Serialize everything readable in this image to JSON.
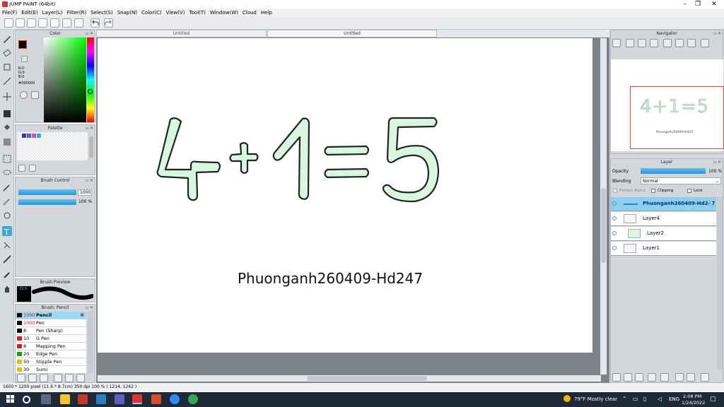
{
  "window": {
    "title": "JUMP PAINT (64bit)"
  },
  "menu": [
    "File(F)",
    "Edit(E)",
    "Layer(L)",
    "Filter(R)",
    "Select(S)",
    "Snap(N)",
    "Color(C)",
    "View(V)",
    "Tool(T)",
    "Window(W)",
    "Cloud",
    "Help"
  ],
  "tabs": [
    {
      "label": "Untitled"
    },
    {
      "label": "Untitled"
    }
  ],
  "panels": {
    "color": {
      "title": "Color",
      "r": "R:0",
      "g": "G:0",
      "b": "B:0",
      "hex": "#000000",
      "current_color": "#000000"
    },
    "palette": {
      "title": "Palette",
      "swatches": [
        "#3b3b9e",
        "#5b5bd0",
        "#d4559e",
        "#3fa7d6"
      ]
    },
    "brush_control": {
      "title": "Brush Control",
      "size": "1000",
      "opacity": "100 %"
    },
    "brush_preview": {
      "title": "Brush Preview",
      "size": "72.5"
    },
    "brush_list": {
      "title": "Brush: Pencil",
      "items": [
        {
          "size": "1000",
          "name": "Pencil",
          "color": "#000000",
          "selected": true
        },
        {
          "size": "1000",
          "name": "Pen",
          "color": "#000000"
        },
        {
          "size": "8",
          "name": "Pen (Sharp)",
          "color": "#000000"
        },
        {
          "size": "10",
          "name": "G Pen",
          "color": "#d32020"
        },
        {
          "size": "8",
          "name": "Mapping Pen",
          "color": "#d32020"
        },
        {
          "size": "20",
          "name": "Edge Pen",
          "color": "#18a018"
        },
        {
          "size": "50",
          "name": "Stipple Pen",
          "color": "#e0c000"
        },
        {
          "size": "30",
          "name": "Sumi",
          "color": "#e0c000"
        }
      ]
    },
    "navigator": {
      "title": "Navigator",
      "thumb_text": "4+1=5",
      "thumb_caption": "Phuonganh260409-Hd247"
    },
    "layer": {
      "title": "Layer",
      "opacity_label": "Opacity",
      "opacity_value": "100 %",
      "blending_label": "Blending",
      "blending_value": "Normal",
      "protect_alpha": "Protect Alpha",
      "clipping": "Clipping",
      "lock": "Lock",
      "layers": [
        {
          "name": "Phuonganh260409-Hd247",
          "selected": true
        },
        {
          "name": "Layer4"
        },
        {
          "name": "Layer2"
        },
        {
          "name": "Layer1"
        }
      ]
    }
  },
  "canvas": {
    "equation": "4+1=5",
    "caption": "Phuonganh260409-Hd247",
    "fill_color": "#d7f7de"
  },
  "status": {
    "text": "1600 * 1200 pixel  (11.6 * 8.7cm)  350 dpi  100 %  ( 1214, 1242 )"
  },
  "taskbar": {
    "weather": "79°F  Mostly clear",
    "lang": "ENG",
    "time": "2:08 PM",
    "date": "1/24/2022"
  }
}
